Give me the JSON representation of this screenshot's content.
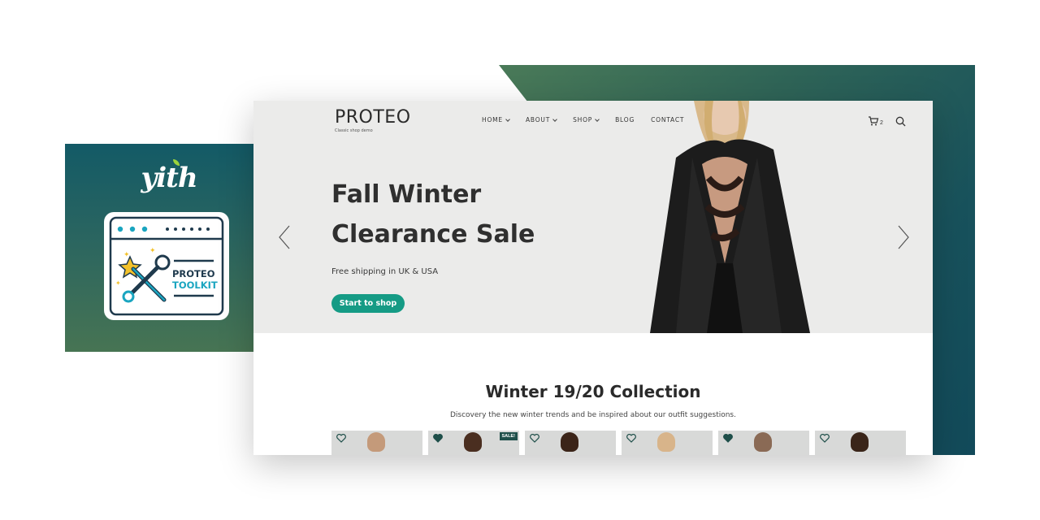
{
  "plugin": {
    "logo_text": "yith",
    "card_title_line1": "PROTEO",
    "card_title_line2": "TOOLKIT"
  },
  "site": {
    "brand": "PROTEO",
    "brand_tagline": "Classic shop demo",
    "nav": [
      {
        "label": "HOME",
        "has_dropdown": true
      },
      {
        "label": "ABOUT",
        "has_dropdown": true
      },
      {
        "label": "SHOP",
        "has_dropdown": true
      },
      {
        "label": "BLOG",
        "has_dropdown": false
      },
      {
        "label": "CONTACT",
        "has_dropdown": false
      }
    ],
    "cart_count": "2",
    "hero": {
      "title": "Fall Winter Clearance Sale",
      "subtitle": "Free shipping in UK & USA",
      "button_label": "Start to shop"
    },
    "collection": {
      "title": "Winter 19/20 Collection",
      "subtitle": "Discovery the new winter trends and be inspired about our outfit suggestions."
    },
    "products": [
      {
        "wishlisted": false,
        "sale_badge": ""
      },
      {
        "wishlisted": true,
        "sale_badge": "SALE!"
      },
      {
        "wishlisted": false,
        "sale_badge": ""
      },
      {
        "wishlisted": false,
        "sale_badge": ""
      },
      {
        "wishlisted": true,
        "sale_badge": ""
      },
      {
        "wishlisted": false,
        "sale_badge": ""
      }
    ]
  },
  "colors": {
    "accent": "#159b85",
    "panel_dark": "#124a5a",
    "panel_green": "#477453",
    "sale_badge": "#1f4f4a",
    "logo_leaf": "#9bd33c",
    "icon_blue": "#1aa5c0",
    "icon_yellow": "#f3c22b"
  }
}
